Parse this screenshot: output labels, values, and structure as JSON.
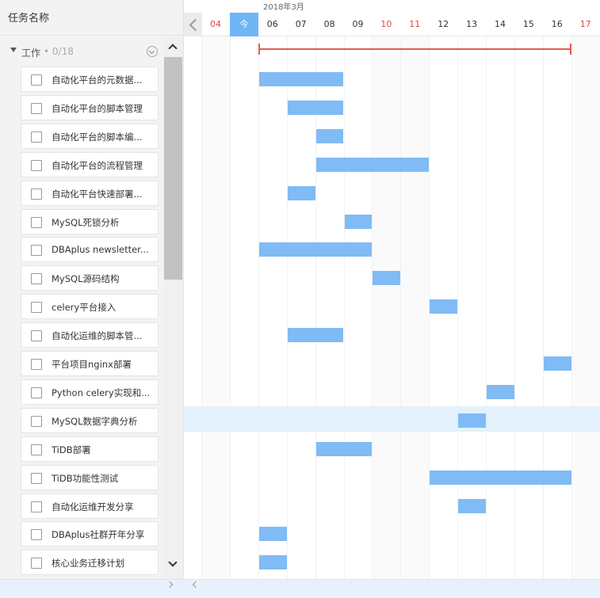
{
  "header": {
    "task_column_title": "任务名称"
  },
  "group": {
    "name": "工作",
    "count": "• 0/18"
  },
  "tasks": [
    {
      "label": "自动化平台的元数据...",
      "start": 6,
      "end": 8
    },
    {
      "label": "自动化平台的脚本管理",
      "start": 7,
      "end": 8
    },
    {
      "label": "自动化平台的脚本编...",
      "start": 8,
      "end": 8
    },
    {
      "label": "自动化平台的流程管理",
      "start": 8,
      "end": 11
    },
    {
      "label": "自动化平台快速部署...",
      "start": 7,
      "end": 7
    },
    {
      "label": "MySQL死锁分析",
      "start": 9,
      "end": 9
    },
    {
      "label": "DBAplus newsletter...",
      "start": 6,
      "end": 9
    },
    {
      "label": "MySQL源码结构",
      "start": 10,
      "end": 10
    },
    {
      "label": "celery平台接入",
      "start": 12,
      "end": 12
    },
    {
      "label": "自动化运维的脚本管...",
      "start": 7,
      "end": 8
    },
    {
      "label": "平台项目nginx部署",
      "start": 16,
      "end": 16
    },
    {
      "label": "Python celery实现和...",
      "start": 14,
      "end": 14
    },
    {
      "label": "MySQL数据字典分析",
      "start": 13,
      "end": 13
    },
    {
      "label": "TiDB部署",
      "start": 8,
      "end": 9
    },
    {
      "label": "TiDB功能性测试",
      "start": 12,
      "end": 16
    },
    {
      "label": "自动化运维开发分享",
      "start": 13,
      "end": 13
    },
    {
      "label": "DBAplus社群开年分享",
      "start": 6,
      "end": 6
    },
    {
      "label": "核心业务迁移计划",
      "start": 6,
      "end": 6
    }
  ],
  "timeline": {
    "month": "2018年3月",
    "dates": [
      {
        "label": "04",
        "red": true
      },
      {
        "label": "今",
        "today": true
      },
      {
        "label": "06"
      },
      {
        "label": "07"
      },
      {
        "label": "08"
      },
      {
        "label": "09"
      },
      {
        "label": "10",
        "red": true
      },
      {
        "label": "11",
        "red": true
      },
      {
        "label": "12"
      },
      {
        "label": "13"
      },
      {
        "label": "14"
      },
      {
        "label": "15"
      },
      {
        "label": "16"
      },
      {
        "label": "17",
        "red": true
      }
    ],
    "first_day": 4,
    "summary": {
      "start": 6,
      "end": 16
    },
    "highlighted_task": 12
  },
  "colors": {
    "bar": "#80bbf5",
    "summary": "#e55b54",
    "today": "#70b5f5",
    "weekend_text": "#e0463f"
  }
}
